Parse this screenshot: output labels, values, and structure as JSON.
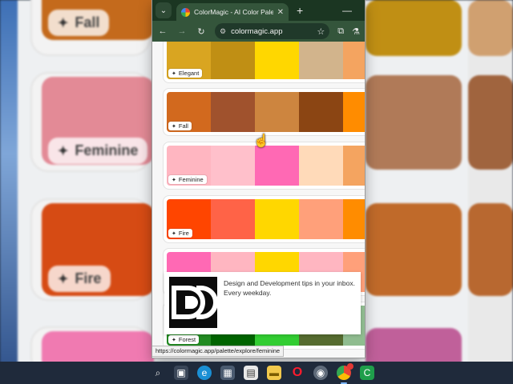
{
  "background": {
    "cards": [
      {
        "label": "Fall",
        "color": "#c46a1c"
      },
      {
        "label": "Feminine",
        "color": "#e38a96"
      },
      {
        "label": "Fire",
        "color": "#d64b14"
      }
    ]
  },
  "browser": {
    "tab_title": "ColorMagic - AI Color Palette G",
    "url": "colormagic.app",
    "status_url": "https://colormagic.app/palette/explore/feminine"
  },
  "palettes": [
    {
      "label": "Elegant",
      "colors": [
        "#d9a521",
        "#c08f14",
        "#ffd700",
        "#d2b48c",
        "#f4a460"
      ]
    },
    {
      "label": "Fall",
      "colors": [
        "#d2691e",
        "#a0522d",
        "#cd853f",
        "#8b4513",
        "#ff8c00"
      ]
    },
    {
      "label": "Feminine",
      "colors": [
        "#ffb6c1",
        "#ffc0cb",
        "#ff69b4",
        "#ffdab9",
        "#f4a460"
      ]
    },
    {
      "label": "Fire",
      "colors": [
        "#ff4500",
        "#ff6347",
        "#ffd700",
        "#ffa07a",
        "#ff8c00"
      ]
    },
    {
      "label": "",
      "colors": [
        "#ff69b4",
        "#ffb6c1",
        "#ffd700",
        "#ffb6c1",
        "#ffa07a"
      ]
    },
    {
      "label": "Forest",
      "colors": [
        "#228b22",
        "#006400",
        "#32cd32",
        "#556b2f",
        "#8fbc8f"
      ]
    }
  ],
  "ad": {
    "text": "Design and Development tips in your inbox. Every weekday."
  },
  "taskbar": {
    "icons": [
      "search-icon",
      "task-view-icon",
      "edge-icon",
      "store-icon",
      "widgets-icon",
      "file-explorer-icon",
      "opera-icon",
      "chrome-dev-icon",
      "chrome-icon",
      "camtasia-icon"
    ]
  }
}
